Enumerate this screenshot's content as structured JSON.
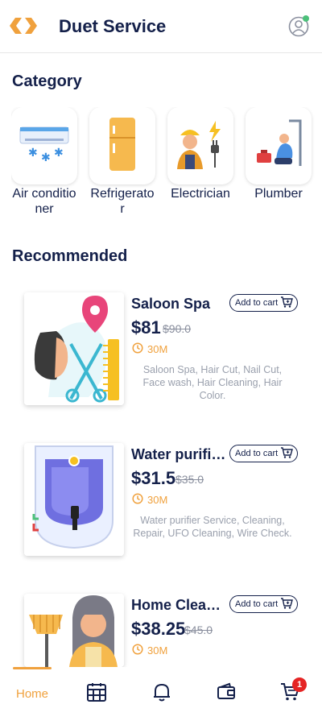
{
  "header": {
    "title": "Duet Service",
    "logo_icon": "duet-logo-icon",
    "profile_icon": "profile-icon",
    "accent_color": "#f0a13d",
    "brand_color": "#14204a"
  },
  "category": {
    "title": "Category",
    "items": [
      {
        "label": "Air conditioner",
        "icon": "air-conditioner-icon"
      },
      {
        "label": "Refrigerator",
        "icon": "refrigerator-icon"
      },
      {
        "label": "Electrician",
        "icon": "electrician-icon"
      },
      {
        "label": "Plumber",
        "icon": "plumber-icon"
      }
    ]
  },
  "recommended": {
    "title": "Recommended",
    "add_to_cart_label": "Add to cart",
    "items": [
      {
        "title": "Saloon Spa",
        "price": "$81",
        "old_price": "$90.0",
        "duration": "30M",
        "description": "Saloon Spa, Hair Cut, Nail Cut, Face wash, Hair Cleaning, Hair Color."
      },
      {
        "title": "Water purifier Service",
        "price": "$31.5",
        "old_price": "$35.0",
        "duration": "30M",
        "description": "Water purifier Service, Cleaning, Repair, UFO Cleaning, Wire Check."
      },
      {
        "title": "Home Cleaning",
        "price": "$38.25",
        "old_price": "$45.0",
        "duration": "30M",
        "description": ""
      }
    ]
  },
  "bottom_nav": {
    "home_label": "Home",
    "cart_count": "1",
    "icons": [
      "calendar-icon",
      "bell-icon",
      "wallet-icon",
      "cart-icon"
    ]
  }
}
